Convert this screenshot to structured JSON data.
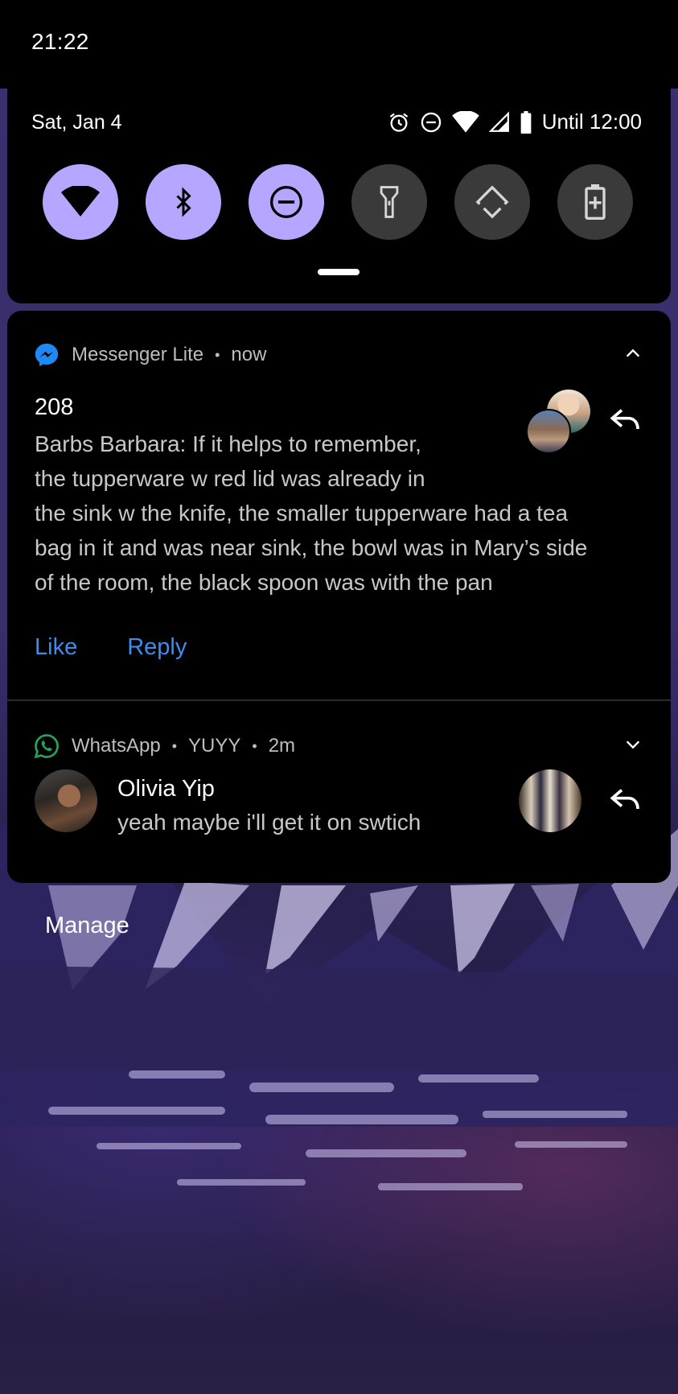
{
  "status_bar": {
    "time": "21:22"
  },
  "quick_settings": {
    "date": "Sat, Jan 4",
    "status_text": "Until 12:00",
    "status_icons": [
      "alarm-icon",
      "do-not-disturb-icon",
      "wifi-icon",
      "signal-icon",
      "battery-icon"
    ],
    "tiles": [
      {
        "name": "wifi",
        "icon": "wifi-icon",
        "active": true
      },
      {
        "name": "bluetooth",
        "icon": "bluetooth-icon",
        "active": true
      },
      {
        "name": "do-not-disturb",
        "icon": "do-not-disturb-icon",
        "active": true
      },
      {
        "name": "flashlight",
        "icon": "flashlight-icon",
        "active": false
      },
      {
        "name": "auto-rotate",
        "icon": "auto-rotate-icon",
        "active": false
      },
      {
        "name": "battery-saver",
        "icon": "battery-saver-icon",
        "active": false
      }
    ],
    "accent": "#b7a6ff"
  },
  "notifications": [
    {
      "app": "Messenger Lite",
      "time": "now",
      "title": "208",
      "body_lines": [
        "Barbs Barbara: If it helps to remember,",
        "the tupperware w red lid was already in",
        "the sink w the knife, the smaller tupperware had a tea",
        "bag in it and was near sink, the bowl was in Mary’s side",
        "of the room, the black spoon was with the pan"
      ],
      "actions": [
        "Like",
        "Reply"
      ],
      "app_color": "#1e88f5"
    },
    {
      "app": "WhatsApp",
      "conversation": "YUYY",
      "time": "2m",
      "sender": "Olivia Yip",
      "message": "yeah maybe i'll get it on swtich",
      "app_color": "#25a35a"
    }
  ],
  "separator": "•",
  "manage_label": "Manage",
  "action_color": "#3b8ef0"
}
